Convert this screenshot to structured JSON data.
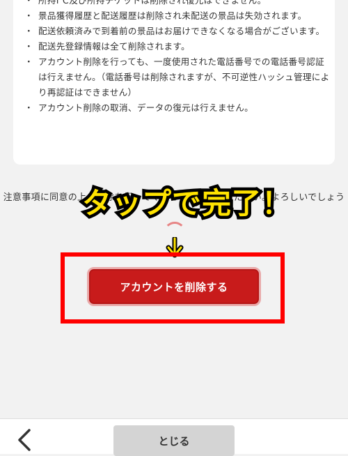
{
  "notice": {
    "items": [
      "所持I℃及び所持チケットは削除され復元はできません。",
      "景品獲得履歴と配送履歴は削除され未配送の景品は失効されます。",
      "配送依頼済みで到着前の景品はお届けできなくなる場合がございます。",
      "配送先登録情報は全て削除されます。",
      "アカウント削除を行っても、一度使用された電話番号での電話番号認証は行えません。（電話番号は削除されますが、不可逆性ハッシュ管理により再認証はできません）",
      "アカウント削除の取消、データの復元は行えません。"
    ]
  },
  "caution": {
    "text": "注意事項に同意の上、削除を行ってください。ご了承ください。よろしいでしょう"
  },
  "annotation": {
    "text": "タップで完了！"
  },
  "delete_button": {
    "label": "アカウントを削除する"
  },
  "footer": {
    "close_label": "とじる"
  },
  "colors": {
    "danger": "#c81b1b",
    "highlight": "#ff0000",
    "annotation": "#ffe300"
  }
}
